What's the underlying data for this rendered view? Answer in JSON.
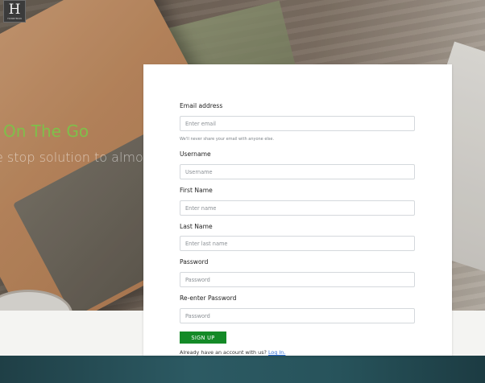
{
  "branding": {
    "logo_letter": "H",
    "logo_tagline": "HANDYMAN"
  },
  "hero": {
    "title": "On The Go",
    "subtitle": "e stop solution to almost e"
  },
  "form": {
    "email": {
      "label": "Email address",
      "placeholder": "Enter email",
      "value": "",
      "help": "We'll never share your email with anyone else."
    },
    "username": {
      "label": "Username",
      "placeholder": "Username",
      "value": ""
    },
    "first_name": {
      "label": "First Name",
      "placeholder": "Enter name",
      "value": ""
    },
    "last_name": {
      "label": "Last Name",
      "placeholder": "Enter last name",
      "value": ""
    },
    "password": {
      "label": "Password",
      "placeholder": "Password",
      "value": ""
    },
    "confirm_password": {
      "label": "Re-enter Password",
      "placeholder": "Password",
      "value": ""
    },
    "submit_label": "SIGN UP",
    "login_prompt": "Already have an account with us?",
    "login_link": "Log In."
  },
  "colors": {
    "accent_green": "#148a27",
    "hero_title": "#7fbf4a",
    "link_blue": "#2f6fd6",
    "footer_teal": "#27535b"
  }
}
